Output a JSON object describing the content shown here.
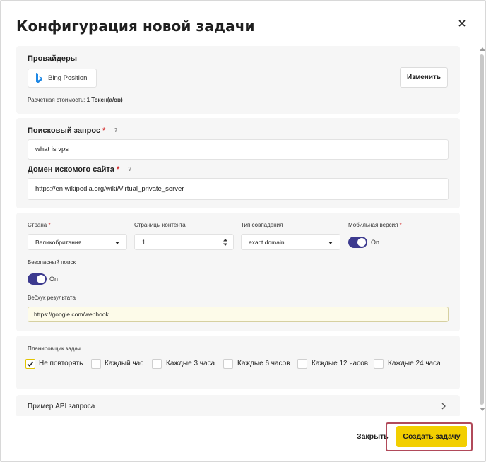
{
  "dialog": {
    "title": "Конфигурация новой задачи"
  },
  "providers": {
    "heading": "Провайдеры",
    "provider_name": "Bing Position",
    "change_label": "Изменить",
    "cost_label": "Расчетная стоимость:",
    "cost_value": "1 Токен(а/ов)"
  },
  "query": {
    "search_label": "Поисковый запрос",
    "search_value": "what is vps",
    "domain_label": "Домен искомого сайта",
    "domain_value": "https://en.wikipedia.org/wiki/Virtual_private_server",
    "required_mark": "*",
    "help_mark": "?"
  },
  "settings": {
    "country_label": "Страна",
    "country_value": "Великобритания",
    "pages_label": "Страницы контента",
    "pages_value": "1",
    "match_label": "Тип совпадения",
    "match_value": "exact domain",
    "mobile_label": "Мобильная версия",
    "mobile_state": "On",
    "safe_label": "Безопасный поиск",
    "safe_state": "On",
    "webhook_label": "Вебхук результата",
    "webhook_value": "https://google.com/webhook"
  },
  "scheduler": {
    "heading": "Планировщик задач",
    "options": [
      {
        "label": "Не повторять",
        "checked": true
      },
      {
        "label": "Каждый час",
        "checked": false
      },
      {
        "label": "Каждые 3 часа",
        "checked": false
      },
      {
        "label": "Каждые 6 часов",
        "checked": false
      },
      {
        "label": "Каждые 12 часов",
        "checked": false
      },
      {
        "label": "Каждые 24 часа",
        "checked": false
      }
    ]
  },
  "api_example": {
    "label": "Пример API запроса"
  },
  "footer": {
    "close_label": "Закрыть",
    "create_label": "Создать задачу"
  },
  "colors": {
    "accent_yellow": "#f2cf00",
    "toggle_purple": "#3c3a8f",
    "required_red": "#d32f2f",
    "bing_blue": "#1e88e5"
  },
  "icons": {
    "close": "close-icon",
    "bing": "bing-logo-icon",
    "chevron": "chevron-right-icon",
    "check": "check-icon"
  }
}
